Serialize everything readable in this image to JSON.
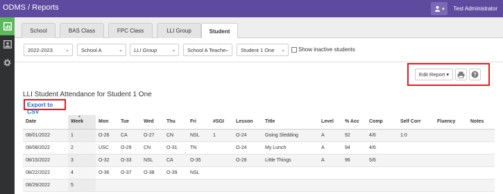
{
  "header": {
    "brand": "ODMS / Reports",
    "user_name": "Test Administrator",
    "user_caret": "▾"
  },
  "tabs": [
    {
      "label": "School"
    },
    {
      "label": "BAS Class"
    },
    {
      "label": "FPC Class"
    },
    {
      "label": "LLI Group"
    },
    {
      "label": "Student"
    }
  ],
  "filters": {
    "year": "2022-2023",
    "school": "School A",
    "group": "LLI Group",
    "teacher": "School A Teache",
    "student": "Student 1 One",
    "show_inactive_label": "Show inactive students",
    "show_inactive_checked": false
  },
  "actions": {
    "edit_report": "Edit Report ▾"
  },
  "report": {
    "title": "LLI Student Attendance for Student 1 One",
    "export_csv": "Export to CSV",
    "sort_indicator": "▲",
    "columns": [
      "Date",
      "Week",
      "Mon",
      "Tue",
      "Wed",
      "Thu",
      "Fri",
      "#SGI",
      "Lesson",
      "Title",
      "Level",
      "% Acc",
      "Comp",
      "Self Corr",
      "Fluency",
      "Notes"
    ],
    "rows": [
      [
        "08/01/2022",
        "1",
        "O-26",
        "CA",
        "O-27",
        "CN",
        "NSL",
        "1",
        "O-24",
        "Going Sledding",
        "A",
        "92",
        "4/6",
        "1:0",
        "",
        ""
      ],
      [
        "08/08/2022",
        "2",
        "USC",
        "O-29",
        "CN",
        "O-31",
        "TN",
        "",
        "O-24",
        "My Lunch",
        "A",
        "94",
        "4/6",
        "",
        "",
        ""
      ],
      [
        "08/15/2022",
        "3",
        "O-32",
        "O-33",
        "NSL",
        "CA",
        "O-35",
        "",
        "O-28",
        "Little Things",
        "A",
        "96",
        "5/6",
        "",
        "",
        ""
      ],
      [
        "08/22/2022",
        "4",
        "O-36",
        "O-37",
        "O-38",
        "O-39",
        "NSL",
        "",
        "",
        "",
        "",
        "",
        "",
        "",
        "",
        ""
      ],
      [
        "08/29/2022",
        "5",
        "",
        "",
        "",
        "",
        "",
        "",
        "",
        "",
        "",
        "",
        "",
        "",
        "",
        ""
      ]
    ]
  },
  "colors": {
    "topbar": "#5e4a9e",
    "sidebar": "#2f3133",
    "active_icon": "#5cb85c",
    "highlight": "#e01b24",
    "link": "#1a6fc4"
  },
  "icons": {
    "sidebar": [
      "chart-icon",
      "student-card-icon",
      "gear-icon"
    ],
    "header": "user-icon",
    "actions": [
      "print-icon",
      "help-icon"
    ]
  }
}
